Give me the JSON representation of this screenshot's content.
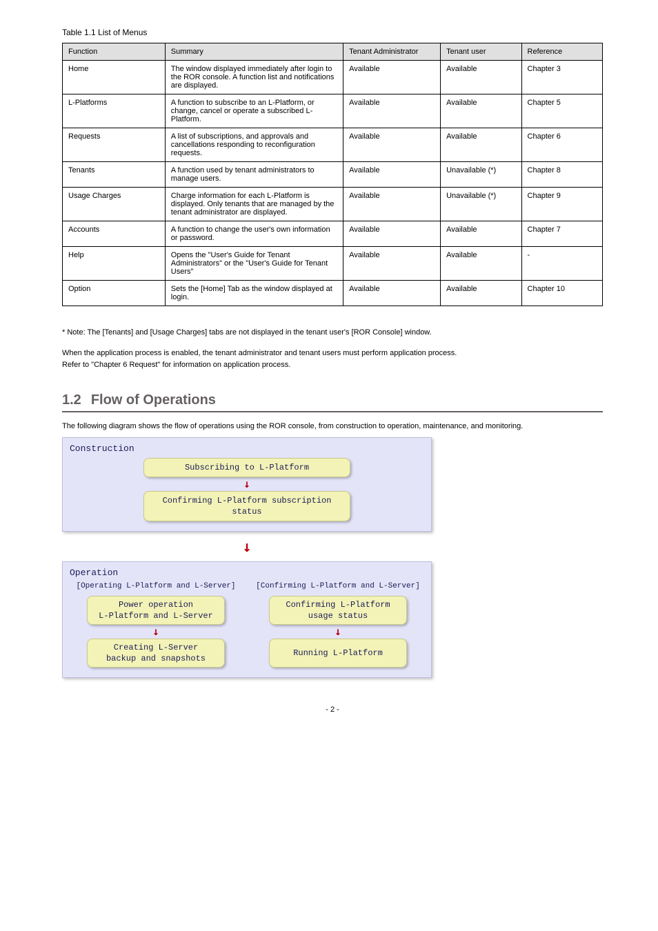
{
  "table_title": "Table 1.1 List of Menus",
  "columns": [
    "Function",
    "Summary",
    "Tenant Administrator",
    "Tenant user",
    "Reference"
  ],
  "rows": [
    [
      "Home",
      "The window displayed immediately after login to the ROR console. A function list and notifications are displayed.",
      "Available",
      "Available",
      "Chapter 3"
    ],
    [
      "L-Platforms",
      "A function to subscribe to an L-Platform, or change, cancel or operate a subscribed L-Platform.",
      "Available",
      "Available",
      "Chapter 5"
    ],
    [
      "Requests",
      "A list of subscriptions, and approvals and cancellations responding to reconfiguration requests.",
      "Available",
      "Available",
      "Chapter 6"
    ],
    [
      "Tenants",
      "A function used by tenant administrators to manage users.",
      "Available",
      "Unavailable (*)",
      "Chapter 8"
    ],
    [
      "Usage Charges",
      "Charge information for each L-Platform is displayed. Only tenants that are managed by the tenant administrator are displayed.",
      "Available",
      "Unavailable (*)",
      "Chapter 9"
    ],
    [
      "Accounts",
      "A function to change the user's own information or password.",
      "Available",
      "Available",
      "Chapter 7"
    ],
    [
      "Help",
      "Opens the \"User's Guide for Tenant Administrators\" or the \"User's Guide for Tenant Users\"",
      "Available",
      "Available",
      "-"
    ],
    [
      "Option",
      "Sets the [Home] Tab as the window displayed at login.",
      "Available",
      "Available",
      "Chapter 10"
    ]
  ],
  "footnote": "* Note: The [Tenants] and [Usage Charges] tabs are not displayed in the tenant user's [ROR Console] window.",
  "refer_para": "When the application process is enabled, the tenant administrator and tenant users must perform application process.\nRefer to \"Chapter 6 Request\" for information on application process.",
  "section_num": "1.2",
  "section_title": "Flow of Operations",
  "section_intro": "The following diagram shows the flow of operations using the ROR console, from construction to operation, maintenance, and monitoring.",
  "diagram": {
    "construction_label": "Construction",
    "c_box1": "Subscribing to L-Platform",
    "c_box2": "Confirming L-Platform subscription status",
    "operation_label": "Operation",
    "left_title": "[Operating L-Platform and L-Server]",
    "right_title": "[Confirming L-Platform and L-Server]",
    "l1": "Power operation\nL-Platform and L-Server",
    "l2": "Creating L-Server\nbackup and snapshots",
    "r1": "Confirming L-Platform\nusage status",
    "r2": "Running L-Platform"
  },
  "page_number": "- 2 -"
}
